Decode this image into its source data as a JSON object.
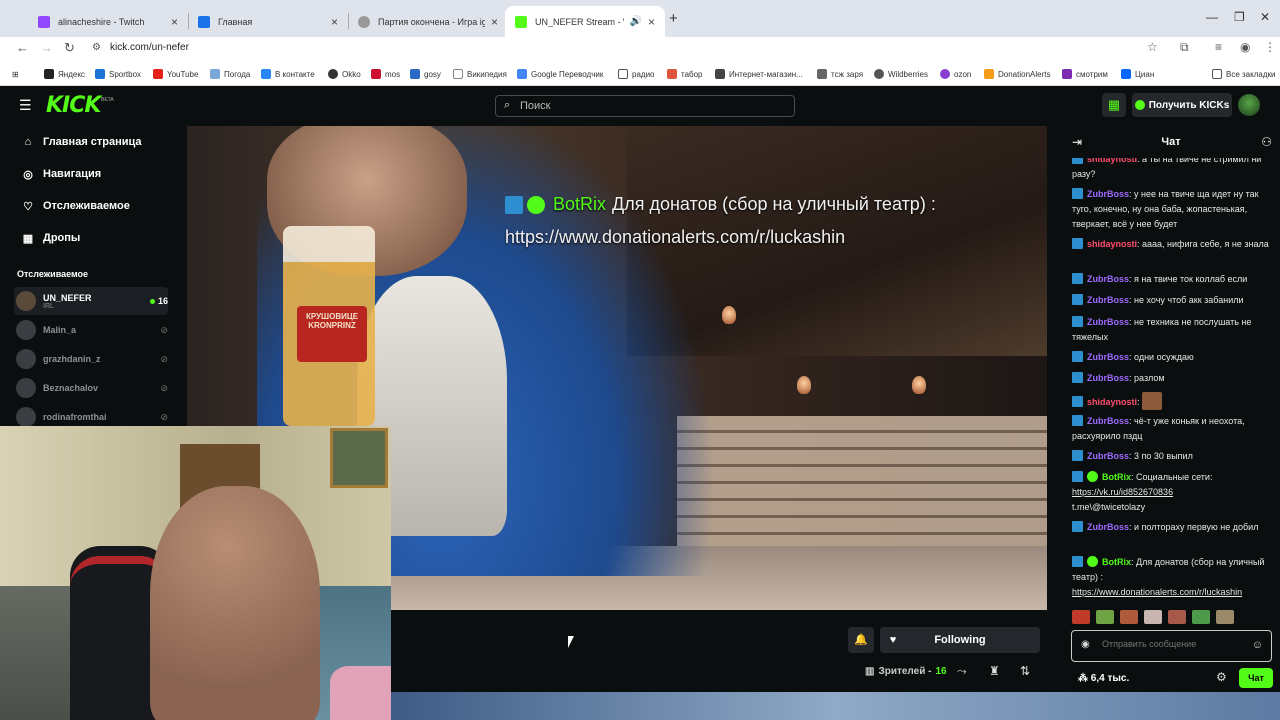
{
  "browser": {
    "tabs": [
      {
        "label": "alinacheshire - Twitch",
        "color": "#9146ff"
      },
      {
        "label": "Главная",
        "color": "#1a73e8"
      },
      {
        "label": "Партия окончена - Игра iguanaunt...",
        "color": "#777777"
      },
      {
        "label": "UN_NEFER Stream - Watch",
        "color": "#53fc18"
      }
    ],
    "url": "kick.com/un-nefer",
    "bookmarks": [
      "Яндекс",
      "Sportbox",
      "YouTube",
      "Погода",
      "В контакте",
      "Okko",
      "mos",
      "gosy",
      "Википедия",
      "Google Переводчик",
      "радио",
      "табор",
      "Интернет-магазин...",
      "тсж заря",
      "Wildberries",
      "ozon",
      "DonationAlerts",
      "смотрим",
      "Циан"
    ],
    "all_bookmarks": "Все закладки"
  },
  "kick": {
    "logo": "KICK",
    "logo_beta": "BETA",
    "search_placeholder": "Поиск",
    "get_kicks": "Получить KICKs",
    "nav": [
      "Главная страница",
      "Навигация",
      "Отслеживаемое",
      "Дропы"
    ],
    "following_title": "Отслеживаемое",
    "channels": [
      {
        "name": "UN_NEFER",
        "sub": "IRL",
        "viewers": "16",
        "live": true
      },
      {
        "name": "Malin_a",
        "live": false
      },
      {
        "name": "grazhdanin_z",
        "live": false
      },
      {
        "name": "Beznachalov",
        "live": false
      },
      {
        "name": "rodinafromthai",
        "live": false
      }
    ],
    "overlay": {
      "user": "BotRix",
      "text": "Для донатов (сбор на уличный театр) : https://www.donationalerts.com/r/luckashin"
    },
    "beer_label": "КРУШОВИЦЕ KRONPRINZ",
    "follow_button": "Following",
    "viewers_label": "Зрителей -",
    "viewers_count": "16",
    "chat": {
      "title": "Чат",
      "messages": [
        {
          "user": "shidaynosti",
          "color": "#ff4d6d",
          "text": "а ты на твиче не стримил ни разу?"
        },
        {
          "user": "ZubrBoss",
          "color": "#9d6bff",
          "text": "у нее на твиче ща идет ну так туго, конечно, ну она баба, жопастенькая, тверкает, всё у нее будет"
        },
        {
          "user": "shidaynosti",
          "color": "#ff4d6d",
          "text": "аааа, нифига себе, я не знала"
        },
        {
          "user": "ZubrBoss",
          "color": "#9d6bff",
          "text": "я на твиче ток коллаб если"
        },
        {
          "user": "ZubrBoss",
          "color": "#9d6bff",
          "text": "не хочу чтоб акк забанили"
        },
        {
          "user": "ZubrBoss",
          "color": "#9d6bff",
          "text": "не техника не послушать не тяжелых"
        },
        {
          "user": "ZubrBoss",
          "color": "#9d6bff",
          "text": "одни осуждаю"
        },
        {
          "user": "ZubrBoss",
          "color": "#9d6bff",
          "text": "разлом"
        },
        {
          "user": "shidaynosti",
          "color": "#ff4d6d",
          "text": ""
        },
        {
          "user": "ZubrBoss",
          "color": "#9d6bff",
          "text": "чё-т уже коньяк и неохота, расхуярило пздц"
        },
        {
          "user": "ZubrBoss",
          "color": "#9d6bff",
          "text": "3 по 30 выпил"
        },
        {
          "user": "BotRix",
          "color": "#53fc18",
          "text": "Социальные сети:",
          "link": "https://vk.ru/id852670836",
          "extra": "t.me\\@twicetolazy"
        },
        {
          "user": "ZubrBoss",
          "color": "#9d6bff",
          "text": "и полтораху первую не добил"
        },
        {
          "user": "BotRix",
          "color": "#53fc18",
          "text": "Для донатов (сбор на уличный театр) :",
          "link": "https://www.donationalerts.com/r/luckashin"
        }
      ],
      "input_placeholder": "Отправить сообщение",
      "kicks_count": "6,4 тыс.",
      "send_label": "Чат"
    }
  }
}
